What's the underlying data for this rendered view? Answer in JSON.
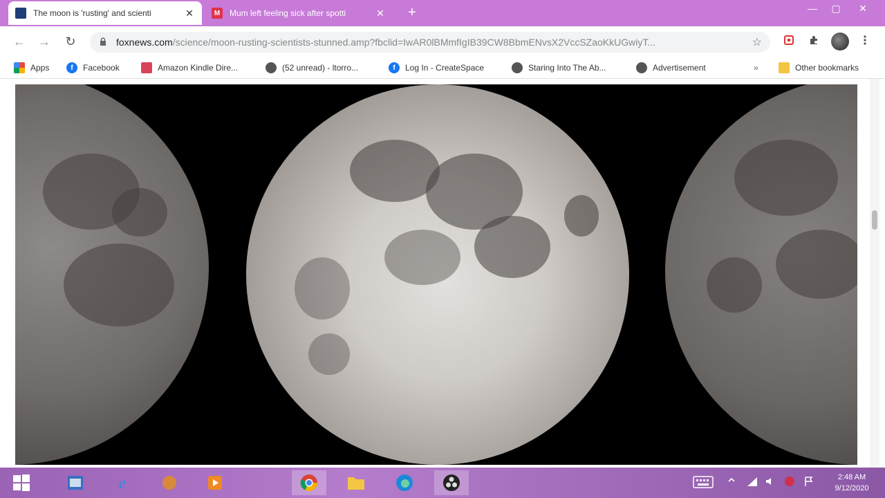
{
  "tabs": [
    {
      "title": "The moon is 'rusting' and scienti",
      "favicon_color": "#1f3e7a",
      "active": true
    },
    {
      "title": "Mum left feeling sick after spotti",
      "favicon_letter": "M",
      "favicon_color": "#e0334a",
      "active": false
    }
  ],
  "toolbar": {
    "url_host": "foxnews.com",
    "url_path": "/science/moon-rusting-scientists-stunned.amp?fbclid=IwAR0lBMmfIgIB39CW8BbmENvsX2VccSZaoKkUGwiyT..."
  },
  "bookmarks": [
    {
      "label": "Apps",
      "icon": "apps-grid-icon",
      "color": "#e24c3f"
    },
    {
      "label": "Facebook",
      "icon": "facebook-icon",
      "color": "#1877f2"
    },
    {
      "label": "Amazon Kindle Dire...",
      "icon": "kindle-icon",
      "color": "#d8455b"
    },
    {
      "label": "(52 unread) - ltorro...",
      "icon": "globe-icon",
      "color": "#555555"
    },
    {
      "label": "Log In - CreateSpace",
      "icon": "facebook-icon",
      "color": "#1877f2"
    },
    {
      "label": "Staring Into The Ab...",
      "icon": "globe-icon",
      "color": "#555555"
    },
    {
      "label": "Advertisement",
      "icon": "globe-icon",
      "color": "#555555"
    }
  ],
  "bookmarks_more": "»",
  "other_bookmarks": "Other bookmarks",
  "clock": {
    "time": "2:48 AM",
    "date": "9/12/2020"
  },
  "icons": {
    "close": "✕",
    "new_tab": "+",
    "back": "←",
    "forward": "→",
    "reload": "↻",
    "lock": "🔒",
    "star": "☆",
    "minimize": "—",
    "maximize": "▢",
    "window_close": "✕"
  }
}
